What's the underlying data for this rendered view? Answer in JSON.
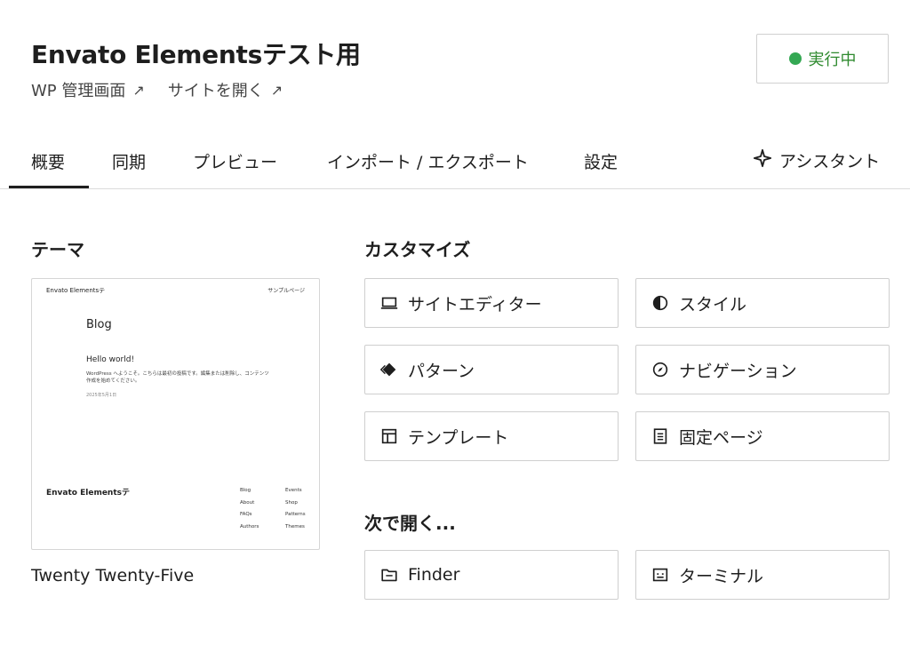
{
  "header": {
    "title": "Envato Elementsテスト用",
    "links": [
      {
        "label": "WP 管理画面",
        "arrow": "↗"
      },
      {
        "label": "サイトを開く",
        "arrow": "↗"
      }
    ],
    "status": {
      "label": "実行中",
      "color": "#34a853"
    }
  },
  "tabs": {
    "items": [
      "概要",
      "同期",
      "プレビュー",
      "インポート / エクスポート",
      "設定"
    ],
    "active": "概要",
    "assistant_label": "アシスタント"
  },
  "theme_section": {
    "heading": "テーマ",
    "preview": {
      "site_title": "Envato Elementsテ",
      "nav_link": "サンプルページ",
      "blog_title": "Blog",
      "post_title": "Hello world!",
      "post_body": "WordPress へようこそ。こちらは最初の投稿です。編集または削除し、コンテンツ作成を始めてください。",
      "post_date": "2025年5月1日",
      "footer_title": "Envato Elementsテ",
      "footer_col1": [
        "Blog",
        "About",
        "FAQs",
        "Authors"
      ],
      "footer_col2": [
        "Events",
        "Shop",
        "Patterns",
        "Themes"
      ]
    },
    "theme_name": "Twenty Twenty-Five"
  },
  "customize_section": {
    "heading": "カスタマイズ",
    "buttons": [
      {
        "label": "サイトエディター",
        "icon": "laptop-icon"
      },
      {
        "label": "スタイル",
        "icon": "contrast-icon"
      },
      {
        "label": "パターン",
        "icon": "diamond-icon"
      },
      {
        "label": "ナビゲーション",
        "icon": "compass-icon"
      },
      {
        "label": "テンプレート",
        "icon": "layout-icon"
      },
      {
        "label": "固定ページ",
        "icon": "page-icon"
      }
    ]
  },
  "open_with_section": {
    "heading": "次で開く...",
    "buttons": [
      {
        "label": "Finder",
        "icon": "folder-icon"
      },
      {
        "label": "ターミナル",
        "icon": "terminal-icon"
      }
    ]
  }
}
